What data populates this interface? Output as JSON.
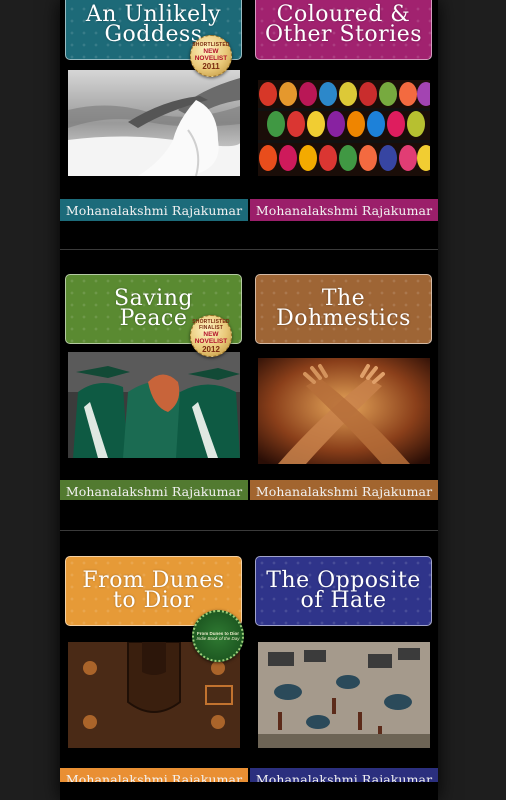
{
  "books": [
    {
      "title": "An Unlikely\nGoddess",
      "author": "Mohanalakshmi Rajakumar",
      "theme_color": "#1d6a78",
      "author_bar_color": "#1c6b7a",
      "badge": {
        "line1": "SHORTLISTED",
        "line2": "NEW NOVELIST",
        "line3": "2011"
      },
      "photo_icon": "beach-woman-image"
    },
    {
      "title": "Coloured &\nOther Stories",
      "author": "Mohanalakshmi Rajakumar",
      "theme_color": "#a1226f",
      "author_bar_color": "#9b1f6a",
      "photo_icon": "colored-lamps-image"
    },
    {
      "title": "Saving\nPeace",
      "author": "Mohanalakshmi Rajakumar",
      "theme_color": "#5a8a31",
      "author_bar_color": "#527a30",
      "badge": {
        "line1": "SHORTLISTED FINALIST",
        "line2": "NEW NOVELIST",
        "line3": "2012"
      },
      "photo_icon": "graduates-image"
    },
    {
      "title": "The Dohmestics",
      "author": "Mohanalakshmi Rajakumar",
      "theme_color": "#9e6535",
      "author_bar_color": "#a2652f",
      "photo_icon": "crossed-hands-image"
    },
    {
      "title": "From Dunes\nto Dior",
      "author": "Mohanalakshmi Rajakumar",
      "theme_color": "#e69a37",
      "author_bar_color": "#e98f33",
      "badge": {
        "line1": "From Dunes to Dior",
        "line2": "Indie Book of the Day"
      },
      "photo_icon": "leather-bag-image"
    },
    {
      "title": "The Opposite\nof Hate",
      "author": "Mohanalakshmi Rajakumar",
      "theme_color": "#2f348a",
      "author_bar_color": "#2b2f7e",
      "photo_icon": "mural-painting-image"
    }
  ]
}
